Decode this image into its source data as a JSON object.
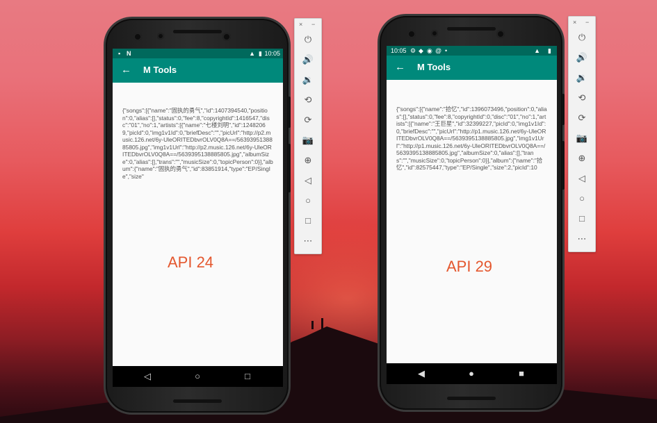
{
  "left_device": {
    "status_time": "10:05",
    "app_title": "M Tools",
    "response_text": "{\"songs\":[{\"name\":\"固执的勇气\",\"id\":1407394540,\"position\":0,\"alias\":[],\"status\":0,\"fee\":8,\"copyrightId\":1416547,\"disc\":\"01\",\"no\":1,\"artists\":[{\"name\":\"七楼刘明\",\"id\":12482069,\"picId\":0,\"img1v1Id\":0,\"briefDesc\":\"\",\"picUrl\":\"http://p2.music.126.net/6y-UleORITEDbvrOLV0Q8A==/5639395138885805.jpg\",\"img1v1Url\":\"http://p2.music.126.net/6y-UleORITEDbvrOLV0Q8A==/5639395138885805.jpg\",\"albumSize\":0,\"alias\":[],\"trans\":\"\",\"musicSize\":0,\"topicPerson\":0}],\"album\":{\"name\":\"固执的勇气\",\"id\":83851914,\"type\":\"EP/Single\",\"size\"",
    "api_label": "API 24"
  },
  "right_device": {
    "status_time": "10:05",
    "app_title": "M Tools",
    "response_text": "{\"songs\":[{\"name\":\"拾忆\",\"id\":1396073496,\"position\":0,\"alias\":[],\"status\":0,\"fee\":8,\"copyrightId\":0,\"disc\":\"01\",\"no\":1,\"artists\":[{\"name\":\"王巨星\",\"id\":32399227,\"picId\":0,\"img1v1Id\":0,\"briefDesc\":\"\",\"picUrl\":\"http://p1.music.126.net/6y-UleORITEDbvrOLV0Q8A==/5639395138885805.jpg\",\"img1v1Url\":\"http://p1.music.126.net/6y-UleORITEDbvrOLV0Q8A==/5639395138885805.jpg\",\"albumSize\":0,\"alias\":[],\"trans\":\"\",\"musicSize\":0,\"topicPerson\":0}],\"album\":{\"name\":\"拾忆\",\"id\":82575447,\"type\":\"EP/Single\",\"size\":2,\"picId\":10",
    "api_label": "API 29"
  },
  "emulator_toolbar": {
    "close": "×",
    "minimize": "−",
    "tools": [
      "power-icon",
      "volume-up-icon",
      "volume-down-icon",
      "rotate-left-icon",
      "rotate-right-icon",
      "camera-icon",
      "zoom-icon",
      "back-icon",
      "home-icon",
      "overview-icon",
      "more-icon"
    ]
  },
  "colors": {
    "appbar": "#00897b",
    "statusbar": "#00695c",
    "api_label": "#e4572e"
  }
}
